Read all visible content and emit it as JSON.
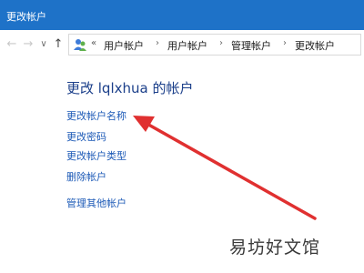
{
  "window": {
    "title": "更改帐户"
  },
  "nav": {
    "back": "←",
    "forward": "→",
    "dropdown": "∨",
    "up": "↑"
  },
  "address": {
    "chevrons": "«",
    "crumbs": [
      "用户帐户",
      "用户帐户",
      "管理帐户",
      "更改帐户"
    ],
    "separator": "›",
    "icon": "user-accounts-icon"
  },
  "content": {
    "heading": "更改 lqlxhua 的帐户",
    "links": [
      "更改帐户名称",
      "更改密码",
      "更改帐户类型",
      "删除帐户",
      "管理其他帐户"
    ]
  },
  "annotation": {
    "arrow_color": "#e03030"
  },
  "watermark": {
    "text": "易坊好文馆"
  }
}
